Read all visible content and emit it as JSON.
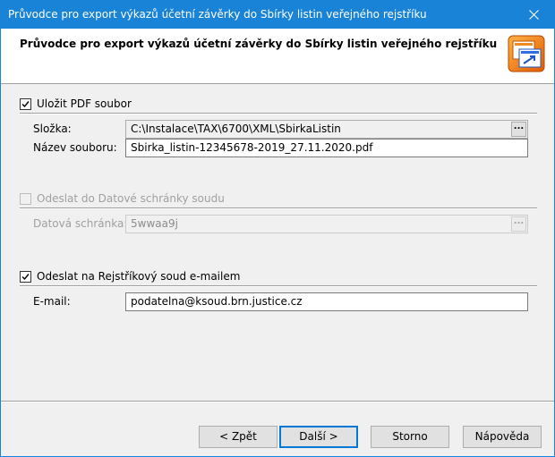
{
  "window": {
    "title": "Průvodce pro export výkazů účetní závěrky do Sbírky listin veřejného rejstříku",
    "close_icon": "close-icon",
    "accent_color": "#1883d7"
  },
  "header": {
    "title": "Průvodce pro export výkazů účetní závěrky do Sbírky listin veřejného rejstříku",
    "logo_icon": "vmware-style-logo-icon"
  },
  "pdf_section": {
    "checkbox_label": "Uložit PDF soubor",
    "checked": true,
    "folder_label": "Složka:",
    "folder_value": "C:\\Instalace\\TAX\\6700\\XML\\SbirkaListin",
    "browse_label": "...",
    "filename_label": "Název souboru:",
    "filename_value": "Sbirka_listin-12345678-2019_27.11.2020.pdf"
  },
  "databox_section": {
    "checkbox_label": "Odeslat do Datové schránky soudu",
    "checked": false,
    "enabled": false,
    "databox_label": "Datová schránka:",
    "databox_value": "5wwaa9j",
    "browse_label": "..."
  },
  "email_section": {
    "checkbox_label": "Odeslat na Rejstříkový soud e-mailem",
    "checked": true,
    "email_label": "E-mail:",
    "email_value": "podatelna@ksoud.brn.justice.cz"
  },
  "buttons": {
    "back": "< Zpět",
    "next": "Další >",
    "cancel": "Storno",
    "help": "Nápověda"
  }
}
